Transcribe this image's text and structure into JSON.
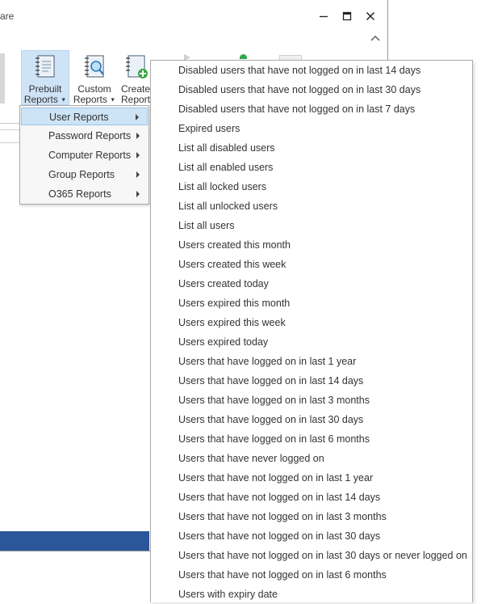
{
  "window": {
    "title_fragment": "are",
    "collapse_glyph": "^"
  },
  "ribbon": {
    "prebuilt": {
      "line1": "Prebuilt",
      "line2": "Reports",
      "icon": "report-book-icon"
    },
    "custom": {
      "line1": "Custom",
      "line2": "Reports",
      "icon": "report-search-icon"
    },
    "create": {
      "line1": "Create",
      "line2": "Report",
      "icon": "report-add-icon"
    },
    "dropdown_glyph": "▼"
  },
  "submenu": {
    "items": [
      {
        "label": "User Reports",
        "active": true
      },
      {
        "label": "Password Reports",
        "active": false
      },
      {
        "label": "Computer Reports",
        "active": false
      },
      {
        "label": "Group Reports",
        "active": false
      },
      {
        "label": "O365 Reports",
        "active": false
      }
    ]
  },
  "user_reports_menu": {
    "items": [
      "Disabled users that have not logged on in last 14 days",
      "Disabled users that have not logged on in last 30 days",
      "Disabled users that have not logged on in last 7 days",
      "Expired users",
      "List all disabled users",
      "List all enabled users",
      "List all locked users",
      "List all unlocked users",
      "List all users",
      "Users created this month",
      "Users created this week",
      "Users created today",
      "Users expired this month",
      "Users expired this week",
      "Users expired today",
      "Users that have logged on in last 1 year",
      "Users that have logged on in last 14 days",
      "Users that have logged on in last 3 months",
      "Users that have logged on in last 30 days",
      "Users that have logged on in last 6 months",
      "Users that have never logged on",
      "Users that have not logged on in last 1 year",
      "Users that have not logged on in last 14 days",
      "Users that have not logged on in last 3 months",
      "Users that have not logged on in last 30 days",
      "Users that have not logged on in last 30 days or never logged on",
      "Users that have not logged on in last 6 months",
      "Users with expiry date"
    ]
  },
  "colors": {
    "accent": "#2b579a",
    "selection": "#cde4f7",
    "highlight_border": "#9cc6ea"
  }
}
